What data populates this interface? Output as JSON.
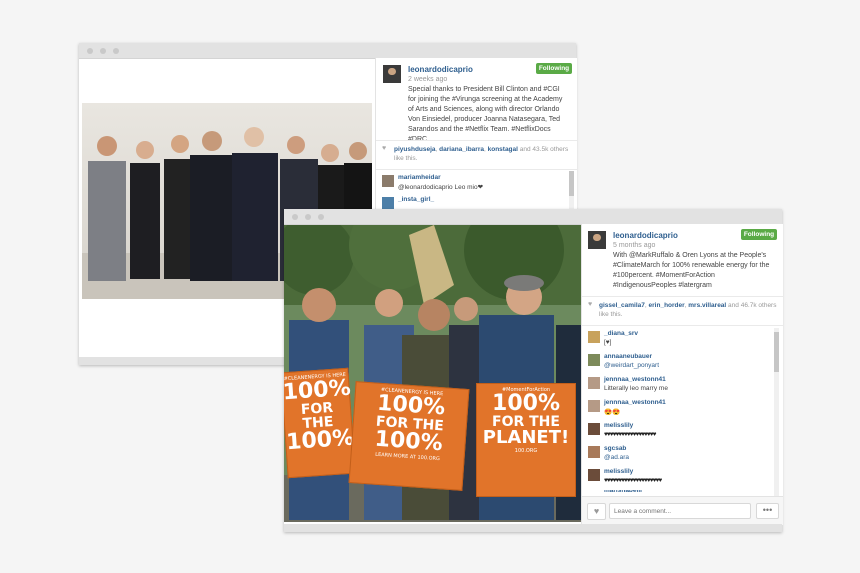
{
  "back_post": {
    "username": "leonardodicaprio",
    "time_ago": "2 weeks ago",
    "follow_label": "Following",
    "caption": "Special thanks to President Bill Clinton and #CGI for joining the #Virunga screening at the Academy of Arts and Sciences, along with director Orlando Von Einsiedel, producer Joanna Natasegara, Ted Sarandos and the #Netflix Team. #NetflixDocs #DRC",
    "likes": {
      "users": [
        "piyushduseja",
        "dariana_ibarra",
        "konstagal"
      ],
      "rest": "and 43.5k others like this."
    },
    "comments": [
      {
        "user": "mariamheidar",
        "text": "@leonardodicaprio Leo mio❤"
      },
      {
        "user": "_insta_girl_",
        "text": ""
      }
    ]
  },
  "front_post": {
    "username": "leonardodicaprio",
    "time_ago": "5 months ago",
    "follow_label": "Following",
    "caption": "With @MarkRuffalo & Oren Lyons at the People's #ClimateMarch for 100% renewable energy for the #100percent. #MomentForAction #IndigenousPeoples #latergram",
    "likes": {
      "users": [
        "gissel_camila7",
        "erin_horder",
        "mrs.villareal"
      ],
      "rest": "and 46.7k others like this."
    },
    "comments": [
      {
        "user": "_diana_srv",
        "text": "[♥]"
      },
      {
        "user": "annaaneubauer",
        "text": "@weirdart_ponyart"
      },
      {
        "user": "jennnaa_westonn41",
        "text": "Litterally leo marry me"
      },
      {
        "user": "jennnaa_westonn41",
        "text": "😍😍"
      },
      {
        "user": "melisslily",
        "text": "♥♥♥♥♥♥♥♥♥♥♥♥♥♥♥♥♥♥"
      },
      {
        "user": "sgcsab",
        "text": "@ad.ara"
      },
      {
        "user": "melisslily",
        "text": "♥♥♥♥♥♥♥♥♥♥♥♥♥♥♥♥♥♥♥♥"
      },
      {
        "user": "marishabelli",
        "text": ""
      }
    ],
    "comment_placeholder": "Leave a comment...",
    "more_label": "•••"
  },
  "signs": [
    {
      "top": "#CLEANENERGY IS HERE",
      "line1": "100%",
      "line2": "FOR THE",
      "line3": "100%"
    },
    {
      "top": "#CLEANENERGY IS HERE",
      "line1": "100%",
      "line2": "FOR THE",
      "line3": "100%",
      "url": "LEARN MORE AT 100.ORG"
    },
    {
      "top": "#MomentForAction",
      "line1": "100%",
      "line2": "FOR THE",
      "line3": "PLANET!",
      "url": "100.ORG"
    }
  ],
  "colors": {
    "follow": "#5aaa46",
    "link": "#2f5f8f",
    "sign": "#e1742a"
  }
}
